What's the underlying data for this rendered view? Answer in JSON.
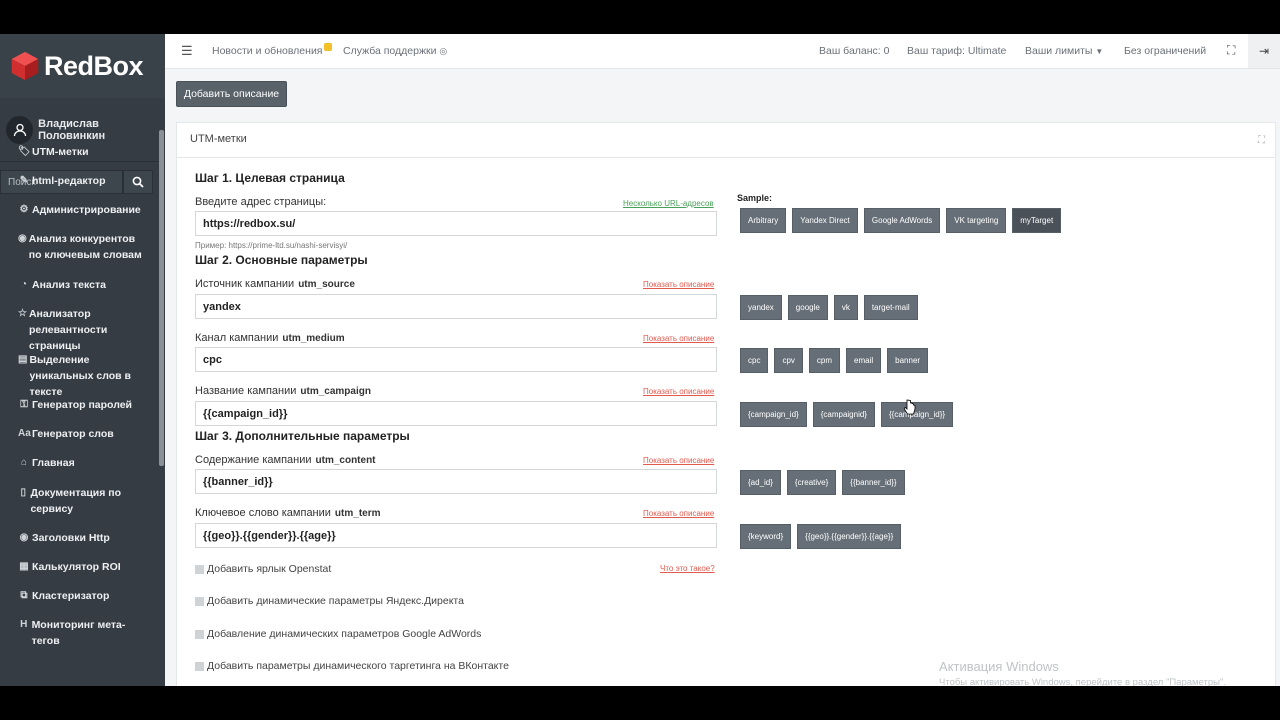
{
  "brand": {
    "logo_text": "RedBox",
    "accent": "#e03a3a"
  },
  "user": {
    "name": "Владислав Половинкин"
  },
  "search": {
    "placeholder": "Поиск"
  },
  "nav": [
    {
      "icon": "tag-icon",
      "glyph": "🏷",
      "label": "UTM-метки"
    },
    {
      "icon": "edit-icon",
      "glyph": "✎",
      "label": "html-редактор"
    },
    {
      "icon": "cogs-icon",
      "glyph": "⚙",
      "label": "Администрирование"
    },
    {
      "icon": "globe-icon",
      "glyph": "◉",
      "label": "Анализ конкурентов по ключевым словам"
    },
    {
      "icon": "pie-icon",
      "glyph": "◔",
      "label": "Анализ текста"
    },
    {
      "icon": "star-icon",
      "glyph": "☆",
      "label": "Анализатор релевантности страницы"
    },
    {
      "icon": "list-icon",
      "glyph": "▤",
      "label": "Выделение уникальных слов в тексте"
    },
    {
      "icon": "key-icon",
      "glyph": "⚿",
      "label": "Генератор паролей"
    },
    {
      "icon": "font-icon",
      "glyph": "Aa",
      "label": "Генератор слов"
    },
    {
      "icon": "home-icon",
      "glyph": "⌂",
      "label": "Главная"
    },
    {
      "icon": "file-icon",
      "glyph": "▯",
      "label": "Документация по сервису"
    },
    {
      "icon": "globe-icon",
      "glyph": "◉",
      "label": "Заголовки Http"
    },
    {
      "icon": "calculator-icon",
      "glyph": "▦",
      "label": "Калькулятор ROI"
    },
    {
      "icon": "sitemap-icon",
      "glyph": "⧉",
      "label": "Кластеризатор"
    },
    {
      "icon": "heading-icon",
      "glyph": "H",
      "label": "Мониторинг мета-тегов"
    }
  ],
  "topbar": {
    "news": "Новости и обновления",
    "support": "Служба поддержки",
    "balance": "Ваш баланс: 0",
    "tariff": "Ваш тариф: Ultimate",
    "limits": "Ваши лимиты",
    "unlimited": "Без ограничений"
  },
  "add_description_button": "Добавить описание",
  "card": {
    "title": "UTM-метки"
  },
  "form": {
    "step1": "Шаг 1. Целевая страница",
    "url_label": "Введите адрес страницы:",
    "multi_url_link": "Несколько URL-адресов",
    "url_value": "https://redbox.su/",
    "url_hint": "Пример: https://prime-ltd.su/nashi-servisyi/",
    "step2": "Шаг 2. Основные параметры",
    "step3": "Шаг 3. Дополнительные параметры",
    "show_desc": "Показать описание",
    "fields": [
      {
        "label": "Источник кампании",
        "param": "utm_source",
        "value": "yandex"
      },
      {
        "label": "Канал кампании",
        "param": "utm_medium",
        "value": "cpc"
      },
      {
        "label": "Название кампании",
        "param": "utm_campaign",
        "value": "{{campaign_id}}"
      },
      {
        "label": "Содержание кампании",
        "param": "utm_content",
        "value": "{{banner_id}}"
      },
      {
        "label": "Ключевое слово кампании",
        "param": "utm_term",
        "value": "{{geo}}.{{gender}}.{{age}}"
      }
    ],
    "what_is_this": "Что это такое?",
    "checkboxes": [
      "Добавить ярлык Openstat",
      "Добавить динамические параметры Яндекс.Директа",
      "Добавление динамических параметров Google AdWords",
      "Добавить параметры динамического таргетинга на ВКонтакте"
    ]
  },
  "sample": {
    "label": "Sample:",
    "presets": [
      "Arbitrary",
      "Yandex Direct",
      "Google AdWords",
      "VK targeting",
      "myTarget"
    ],
    "source": [
      "yandex",
      "google",
      "vk",
      "target-mail"
    ],
    "medium": [
      "cpc",
      "cpv",
      "cpm",
      "email",
      "banner"
    ],
    "campaign": [
      "{campaign_id}",
      "{campaignid}",
      "{{campaign_id}}"
    ],
    "content": [
      "{ad_id}",
      "{creative}",
      "{{banner_id}}"
    ],
    "term": [
      "{keyword}",
      "{{geo}}.{{gender}}.{{age}}"
    ]
  },
  "watermark": {
    "title": "Активация Windows",
    "text": "Чтобы активировать Windows, перейдите в раздел \"Параметры\"."
  }
}
